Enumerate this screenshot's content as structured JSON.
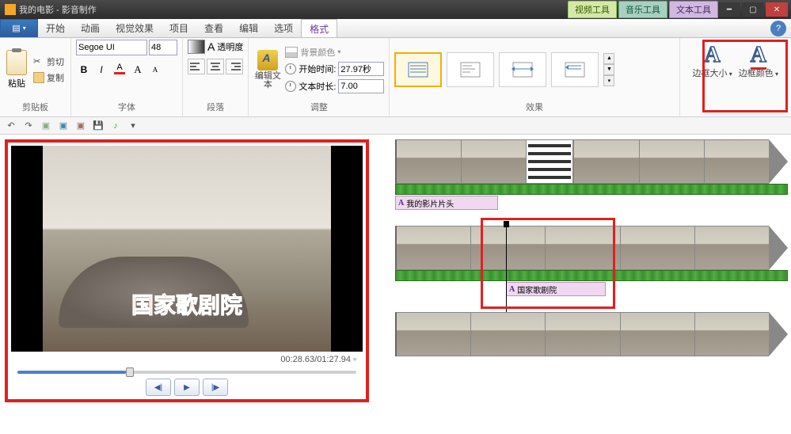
{
  "titlebar": {
    "title": "我的电影 - 影音制作",
    "tools": {
      "video": "视频工具",
      "music": "音乐工具",
      "text": "文本工具"
    }
  },
  "menu": {
    "start": "开始",
    "animation": "动画",
    "visual_effects": "视觉效果",
    "project": "项目",
    "view": "查看",
    "edit": "编辑",
    "options": "选项",
    "format": "格式"
  },
  "ribbon": {
    "clipboard": {
      "paste": "粘贴",
      "cut": "剪切",
      "copy": "复制",
      "label": "剪贴板"
    },
    "font": {
      "name": "Segoe UI",
      "size": "48",
      "label": "字体"
    },
    "transparency": "透明度",
    "paragraph": {
      "label": "段落"
    },
    "adjust": {
      "edit_text": "编辑文本",
      "bg_color": "背景颜色",
      "start_time_label": "开始时间:",
      "start_time_value": "27.97秒",
      "duration_label": "文本时长:",
      "duration_value": "7.00",
      "label": "调整"
    },
    "effects": {
      "label": "效果"
    },
    "outline": {
      "size": "边框大小",
      "color": "边框颜色"
    }
  },
  "preview": {
    "overlay_text": "国家歌剧院",
    "time": "00:28.63/01:27.94"
  },
  "timeline": {
    "text1": "我的影片片头",
    "text2": "国家歌剧院"
  }
}
